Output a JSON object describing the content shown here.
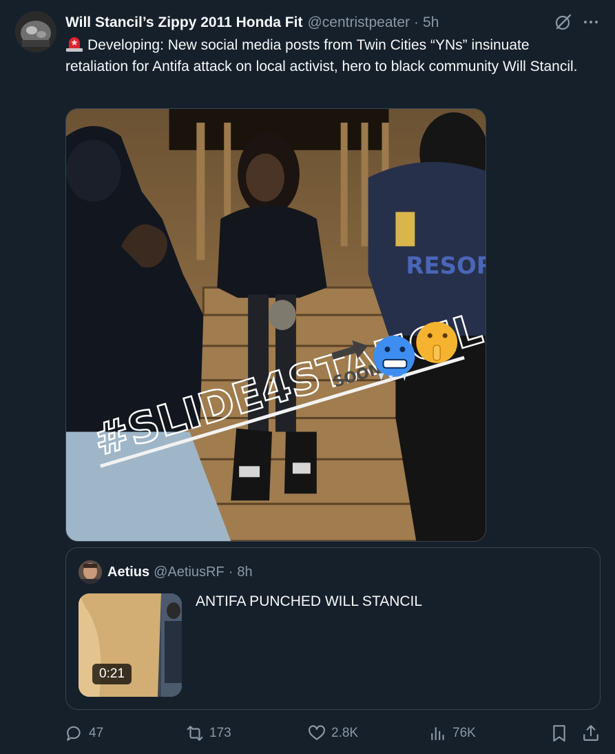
{
  "tweet": {
    "display_name": "Will Stancil’s Zippy 2011 Honda Fit",
    "handle": "@centristpeater",
    "separator": "·",
    "timestamp": "5h",
    "body": "Developing: New social media posts from Twin Cities “YNs” insinuate retaliation for Antifa attack on local activist, hero to black community Will Stancil.",
    "body_prefix_icon": "rotating-light-emoji",
    "media": {
      "overlay_text": "#SLIDE4STANCIL",
      "overlay_subtext": "SOON",
      "emojis": [
        "arrow-right-emoji",
        "cold-face-emoji",
        "shushing-face-emoji"
      ]
    }
  },
  "quote": {
    "display_name": "Aetius",
    "handle": "@AetiusRF",
    "separator": "·",
    "timestamp": "8h",
    "text": "ANTIFA PUNCHED WILL STANCIL",
    "video_duration": "0:21"
  },
  "actions": {
    "replies": "47",
    "reposts": "173",
    "likes": "2.8K",
    "views": "76K"
  },
  "icons": {
    "grok": "grok-icon",
    "more": "more-icon",
    "reply": "reply-icon",
    "repost": "repost-icon",
    "like": "heart-icon",
    "views": "views-icon",
    "bookmark": "bookmark-icon",
    "share": "share-icon"
  },
  "colors": {
    "background": "#15202b",
    "text_primary": "#f7f9f9",
    "text_secondary": "#8b98a5",
    "border": "#38444d"
  }
}
